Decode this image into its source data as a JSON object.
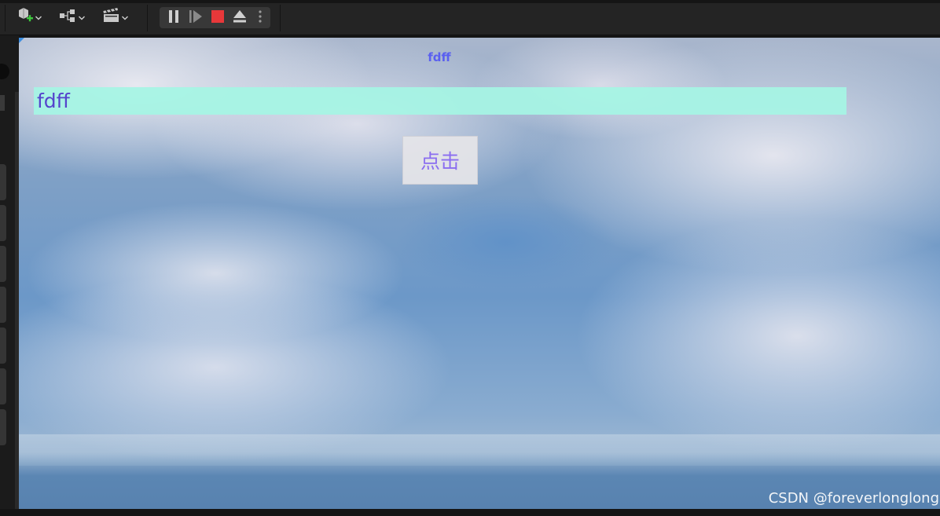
{
  "toolbar": {
    "icons": [
      "add-actor-icon",
      "blueprint-icon",
      "cinematics-icon"
    ],
    "play_controls": [
      "pause-icon",
      "advance-frame-icon",
      "stop-icon",
      "eject-icon",
      "more-options-icon"
    ]
  },
  "viewport": {
    "header_text": "fdff",
    "input_value": "fdff",
    "button_label": "点击"
  },
  "watermark": "CSDN @foreverlonglong",
  "colors": {
    "text_accent": "#5a5ff0",
    "input_bg": "#a5f5e4",
    "button_text": "#8a6df0",
    "stop_red": "#e8383a"
  }
}
